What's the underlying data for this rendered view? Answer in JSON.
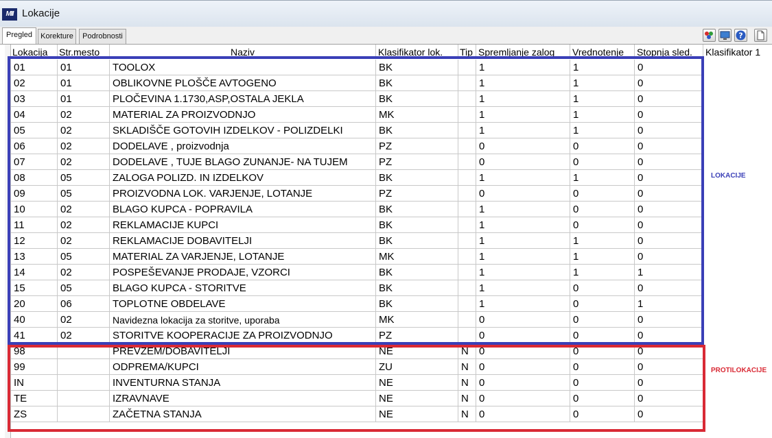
{
  "window": {
    "title": "Lokacije",
    "logo_text": "MII"
  },
  "tabs": [
    {
      "label": "Pregled",
      "active": true
    },
    {
      "label": "Korekture",
      "active": false
    },
    {
      "label": "Podrobnosti",
      "active": false
    }
  ],
  "toolbar": {
    "icons": [
      "palette-icon",
      "monitor-icon",
      "help-icon",
      "new-document-icon"
    ]
  },
  "table": {
    "columns": [
      "Lokacija",
      "Str.mesto",
      "Naziv",
      "Klasifikator lok.",
      "Tip",
      "Spremljanje zalog",
      "Vrednotenje",
      "Stopnja sled.",
      "Klasifikator 1"
    ],
    "rows": [
      [
        "01",
        "01",
        "TOOLOX",
        "BK",
        "",
        "1",
        "1",
        "0"
      ],
      [
        "02",
        "01",
        "OBLIKOVNE PLOŠČE AVTOGENO",
        "BK",
        "",
        "1",
        "1",
        "0"
      ],
      [
        "03",
        "01",
        "PLOČEVINA 1.1730,ASP,OSTALA JEKLA",
        "BK",
        "",
        "1",
        "1",
        "0"
      ],
      [
        "04",
        "02",
        "MATERIAL ZA PROIZVODNJO",
        "MK",
        "",
        "1",
        "1",
        "0"
      ],
      [
        "05",
        "02",
        "SKLADIŠČE GOTOVIH IZDELKOV - POLIZDELKI",
        "BK",
        "",
        "1",
        "1",
        "0"
      ],
      [
        "06",
        "02",
        "DODELAVE , proizvodnja",
        "PZ",
        "",
        "0",
        "0",
        "0"
      ],
      [
        "07",
        "02",
        "DODELAVE , TUJE BLAGO ZUNANJE- NA TUJEM",
        "PZ",
        "",
        "0",
        "0",
        "0"
      ],
      [
        "08",
        "05",
        "ZALOGA POLIZD. IN IZDELKOV",
        "BK",
        "",
        "1",
        "1",
        "0"
      ],
      [
        "09",
        "05",
        "PROIZVODNA LOK. VARJENJE, LOTANJE",
        "PZ",
        "",
        "0",
        "0",
        "0"
      ],
      [
        "10",
        "02",
        "BLAGO KUPCA - POPRAVILA",
        "BK",
        "",
        "1",
        "0",
        "0"
      ],
      [
        "11",
        "02",
        "REKLAMACIJE KUPCI",
        "BK",
        "",
        "1",
        "0",
        "0"
      ],
      [
        "12",
        "02",
        "REKLAMACIJE DOBAVITELJI",
        "BK",
        "",
        "1",
        "1",
        "0"
      ],
      [
        "13",
        "05",
        "MATERIAL ZA VARJENJE, LOTANJE",
        "MK",
        "",
        "1",
        "1",
        "0"
      ],
      [
        "14",
        "02",
        "POSPEŠEVANJE PRODAJE, VZORCI",
        "BK",
        "",
        "1",
        "1",
        "1"
      ],
      [
        "15",
        "05",
        "BLAGO KUPCA - STORITVE",
        "BK",
        "",
        "1",
        "0",
        "0"
      ],
      [
        "20",
        "06",
        "TOPLOTNE OBDELAVE",
        "BK",
        "",
        "1",
        "0",
        "1"
      ],
      [
        "40",
        "02",
        "Navidezna lokacija za storitve, uporaba",
        "MK",
        "",
        "0",
        "0",
        "0"
      ],
      [
        "41",
        "02",
        "STORITVE KOOPERACIJE ZA PROIZVODNJO",
        "PZ",
        "",
        "0",
        "0",
        "0"
      ],
      [
        "98",
        "",
        "PREVZEM/DOBAVITELJI",
        "NE",
        "N",
        "0",
        "0",
        "0"
      ],
      [
        "99",
        "",
        "ODPREMA/KUPCI",
        "ZU",
        "N",
        "0",
        "0",
        "0"
      ],
      [
        "IN",
        "",
        "INVENTURNA STANJA",
        "NE",
        "N",
        "0",
        "0",
        "0"
      ],
      [
        "TE",
        "",
        "IZRAVNAVE",
        "NE",
        "N",
        "0",
        "0",
        "0"
      ],
      [
        "ZS",
        "",
        "ZAČETNA STANJA",
        "NE",
        "N",
        "0",
        "0",
        "0"
      ]
    ]
  },
  "annotations": {
    "lokacije_label": "LOKACIJE",
    "protilokacije_label": "PROTILOKACIJE",
    "lokacije_color": "#3a3fb7",
    "protilokacije_color": "#d92a35"
  }
}
